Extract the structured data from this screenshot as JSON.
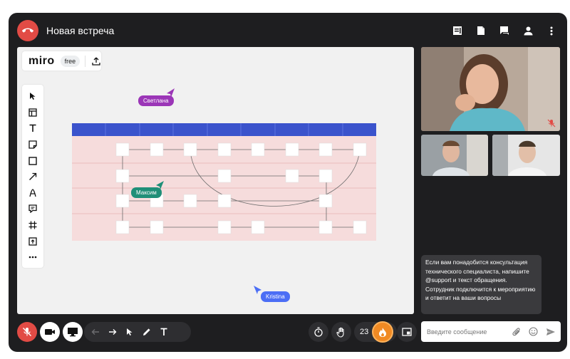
{
  "header": {
    "title": "Новая встреча",
    "icons": [
      "end-call-icon",
      "notes-icon",
      "document-icon",
      "chat-icon",
      "participants-icon",
      "more-icon"
    ]
  },
  "board": {
    "logo": "miro",
    "plan_badge": "free",
    "tools": [
      "select-cursor-icon",
      "template-icon",
      "text-icon",
      "sticky-note-icon",
      "shape-icon",
      "connector-arrow-icon",
      "pen-icon",
      "comment-icon",
      "frame-icon",
      "upload-icon",
      "more-tools-icon"
    ],
    "cursors": [
      {
        "name": "Светлана",
        "color": "#9b36b7"
      },
      {
        "name": "Максим",
        "color": "#1f8f78"
      },
      {
        "name": "Kristina",
        "color": "#4c6ef5"
      }
    ],
    "table_header_color": "#3b53cc",
    "table_body_color": "#f6dcdc"
  },
  "chat": {
    "message": "Если вам понадобится консультация технического специалиста, напишите @support и текст обращения. Сотрудник подключится к мероприятию и ответит на ваши вопросы",
    "input_placeholder": "Введите сообщение"
  },
  "controls": {
    "reactions_count": "23",
    "colors": {
      "danger": "#e24b45",
      "accent": "#f08a24",
      "dark": "#1e1e20"
    }
  }
}
